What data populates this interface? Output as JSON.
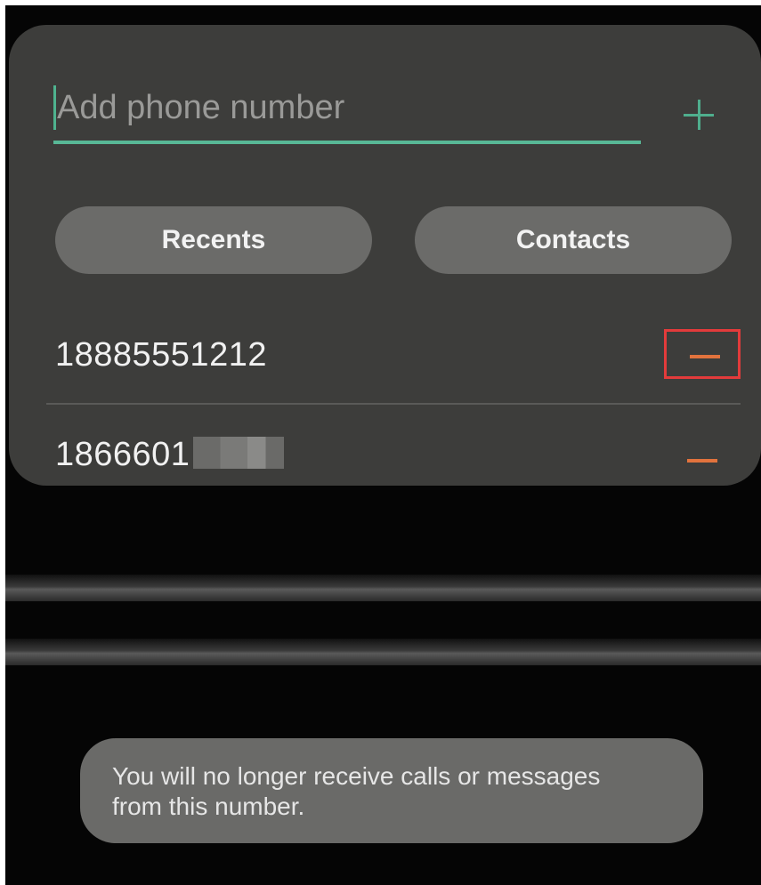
{
  "input": {
    "placeholder": "Add phone number",
    "add_icon": "plus-icon"
  },
  "tabs": {
    "recents_label": "Recents",
    "contacts_label": "Contacts"
  },
  "blocked_numbers": [
    {
      "number": "18885551212",
      "remove_icon": "minus-icon",
      "highlighted": true
    },
    {
      "number": "1866601",
      "redacted_suffix": true,
      "remove_icon": "minus-icon",
      "highlighted": false
    }
  ],
  "toast": {
    "message_line1": "You will no longer receive calls or messages",
    "message_line2": "from this number."
  },
  "colors": {
    "accent_green": "#58b896",
    "remove_orange": "#e2733d",
    "highlight_red": "#e33b3b",
    "panel_bg": "#3d3d3b",
    "pill_bg": "#6b6b69"
  }
}
